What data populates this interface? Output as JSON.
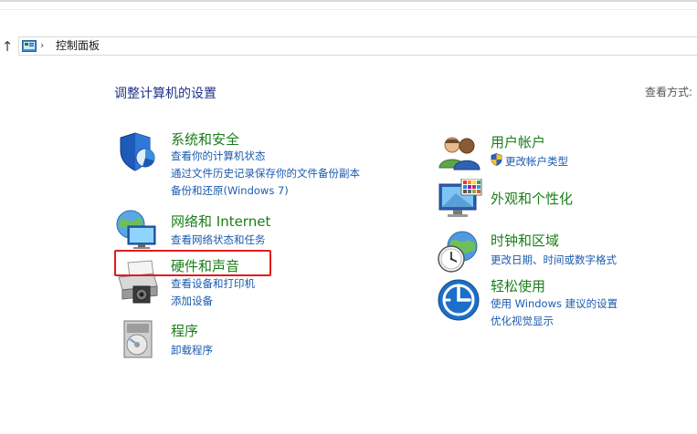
{
  "address_bar": {
    "separator": "›",
    "crumb": "控制面板",
    "up_glyph": "↑"
  },
  "heading": "调整计算机的设置",
  "view_by": "查看方式:",
  "left_column": [
    {
      "id": "security",
      "title": "系统和安全",
      "icon": "shield-pie-icon",
      "links": [
        "查看你的计算机状态",
        "通过文件历史记录保存你的文件备份副本",
        "备份和还原(Windows 7)"
      ]
    },
    {
      "id": "network",
      "title": "网络和 Internet",
      "icon": "globe-network-icon",
      "links": [
        "查看网络状态和任务"
      ]
    },
    {
      "id": "hardware",
      "title": "硬件和声音",
      "icon": "printer-speaker-icon",
      "links": [
        "查看设备和打印机",
        "添加设备"
      ]
    },
    {
      "id": "programs",
      "title": "程序",
      "icon": "programs-disc-icon",
      "links": [
        "卸载程序"
      ]
    }
  ],
  "right_column": [
    {
      "id": "accounts",
      "title": "用户帐户",
      "icon": "users-icon",
      "links": [
        "更改帐户类型"
      ]
    },
    {
      "id": "appearance",
      "title": "外观和个性化",
      "icon": "monitor-palette-icon",
      "links": []
    },
    {
      "id": "clock",
      "title": "时钟和区域",
      "icon": "clock-globe-icon",
      "links": [
        "更改日期、时间或数字格式"
      ]
    },
    {
      "id": "ease",
      "title": "轻松使用",
      "icon": "ease-of-access-icon",
      "links": [
        "使用 Windows 建议的设置",
        "优化视觉显示"
      ]
    }
  ],
  "colors": {
    "category_title": "#1a7d1a",
    "link": "#1a5bb0",
    "heading": "#1e3287",
    "highlight_border": "#e21b1b"
  }
}
